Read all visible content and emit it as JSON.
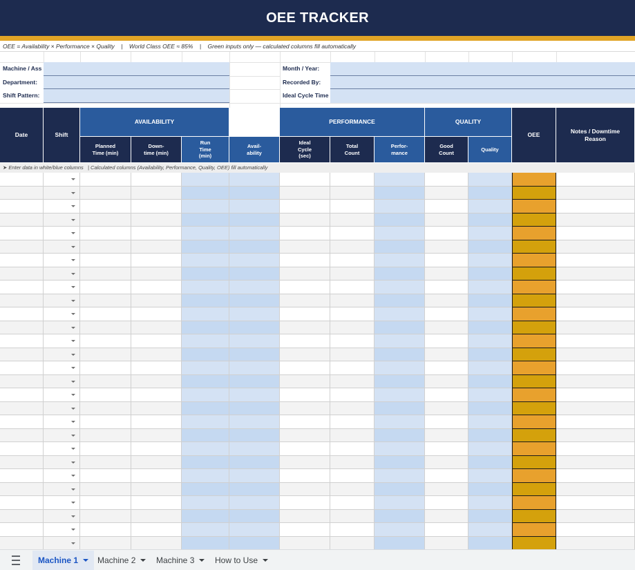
{
  "title": "OEE TRACKER",
  "formula_note": "OEE = Availability × Performance × Quality    |    World Class OEE ≈ 85%    |    Green inputs only — calculated columns fill automatically",
  "info": {
    "machine_label": "Machine / Ass",
    "department_label": "Department:",
    "shift_pattern_label": "Shift Pattern:",
    "month_year_label": "Month / Year:",
    "recorded_by_label": "Recorded By:",
    "ideal_cycle_label": "Ideal Cycle Time"
  },
  "headers": {
    "date": "Date",
    "shift": "Shift",
    "availability_group": "AVAILABILITY",
    "performance_group": "PERFORMANCE",
    "quality_group": "QUALITY",
    "oee": "OEE",
    "notes": "Notes / Downtime Reason",
    "planned_time": "Planned Time (min)",
    "downtime": "Down-time (min)",
    "run_time": "Run Time (min)",
    "availability": "Avail-ability",
    "ideal_cycle": "Ideal Cycle (sec)",
    "total_count": "Total Count",
    "performance": "Perfor-mance",
    "good_count": "Good Count",
    "quality": "Quality"
  },
  "entry_note": "➤ Enter data in white/blue columns   | Calculated columns (Availability, Performance, Quality, OEE) fill automatically",
  "row_count": 28,
  "colors": {
    "navy": "#1d2b4f",
    "header_blue": "#2a5b9d",
    "gold": "#e1a426",
    "input_blue": "#d4e2f4",
    "calc_blue": "#c5d9f1",
    "oee_orange": "#e8a12d",
    "oee_gold": "#d4a10c",
    "row_alt": "#f3f3f3"
  },
  "tabs": [
    {
      "label": "Machine 1",
      "active": true
    },
    {
      "label": "Machine 2",
      "active": false
    },
    {
      "label": "Machine 3",
      "active": false
    },
    {
      "label": "How to Use",
      "active": false
    }
  ],
  "icons": {
    "menu": "hamburger-menu-icon",
    "dropdown": "dropdown-arrow-icon",
    "tab_caret": "caret-down-icon"
  }
}
